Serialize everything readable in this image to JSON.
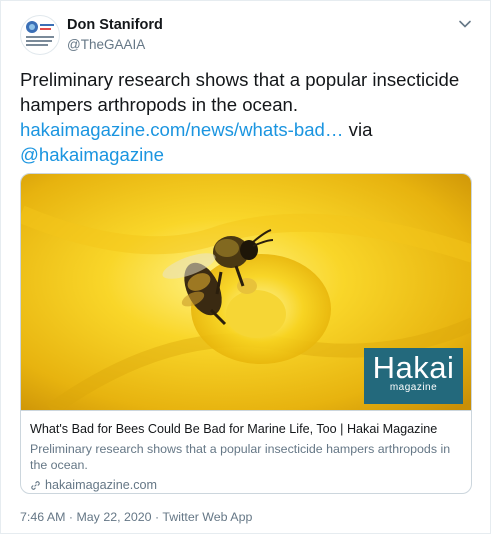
{
  "author": {
    "name": "Don Staniford",
    "handle": "@TheGAAIA"
  },
  "tweet": {
    "text_before": "Preliminary research shows that a popular insecticide hampers arthropods in the ocean.",
    "link_text": "hakaimagazine.com/news/whats-bad…",
    "via_text": " via ",
    "mention": "@hakaimagazine"
  },
  "card": {
    "image_icon": "bee-in-yellow-flower-photo",
    "logo_word": "Hakai",
    "logo_sub": "magazine",
    "title": "What's Bad for Bees Could Be Bad for Marine Life, Too | Hakai Magazine",
    "description": "Preliminary research shows that a popular insecticide hampers arthropods in the ocean.",
    "domain": "hakaimagazine.com"
  },
  "meta": {
    "timestamp": "7:46 AM · May 22, 2020",
    "separator": " · ",
    "source": "Twitter Web App"
  },
  "colors": {
    "link": "#1b95e0",
    "secondary_text": "#657786",
    "border": "#ccd6dd",
    "logo_bg": "#23697c"
  }
}
